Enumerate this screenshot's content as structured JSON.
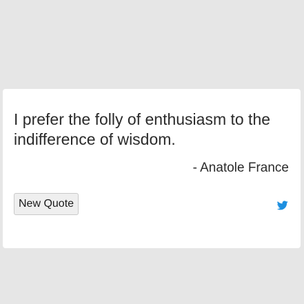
{
  "quote": {
    "text": "I prefer the folly of enthusiasm to the indifference of wisdom.",
    "author": "- Anatole France"
  },
  "actions": {
    "new_quote_label": "New Quote",
    "tweet_icon": "twitter-bird-icon"
  },
  "colors": {
    "background": "#e6e6e6",
    "card": "#ffffff",
    "text": "#2b2b2b",
    "twitter_blue": "#1d8fe0"
  }
}
